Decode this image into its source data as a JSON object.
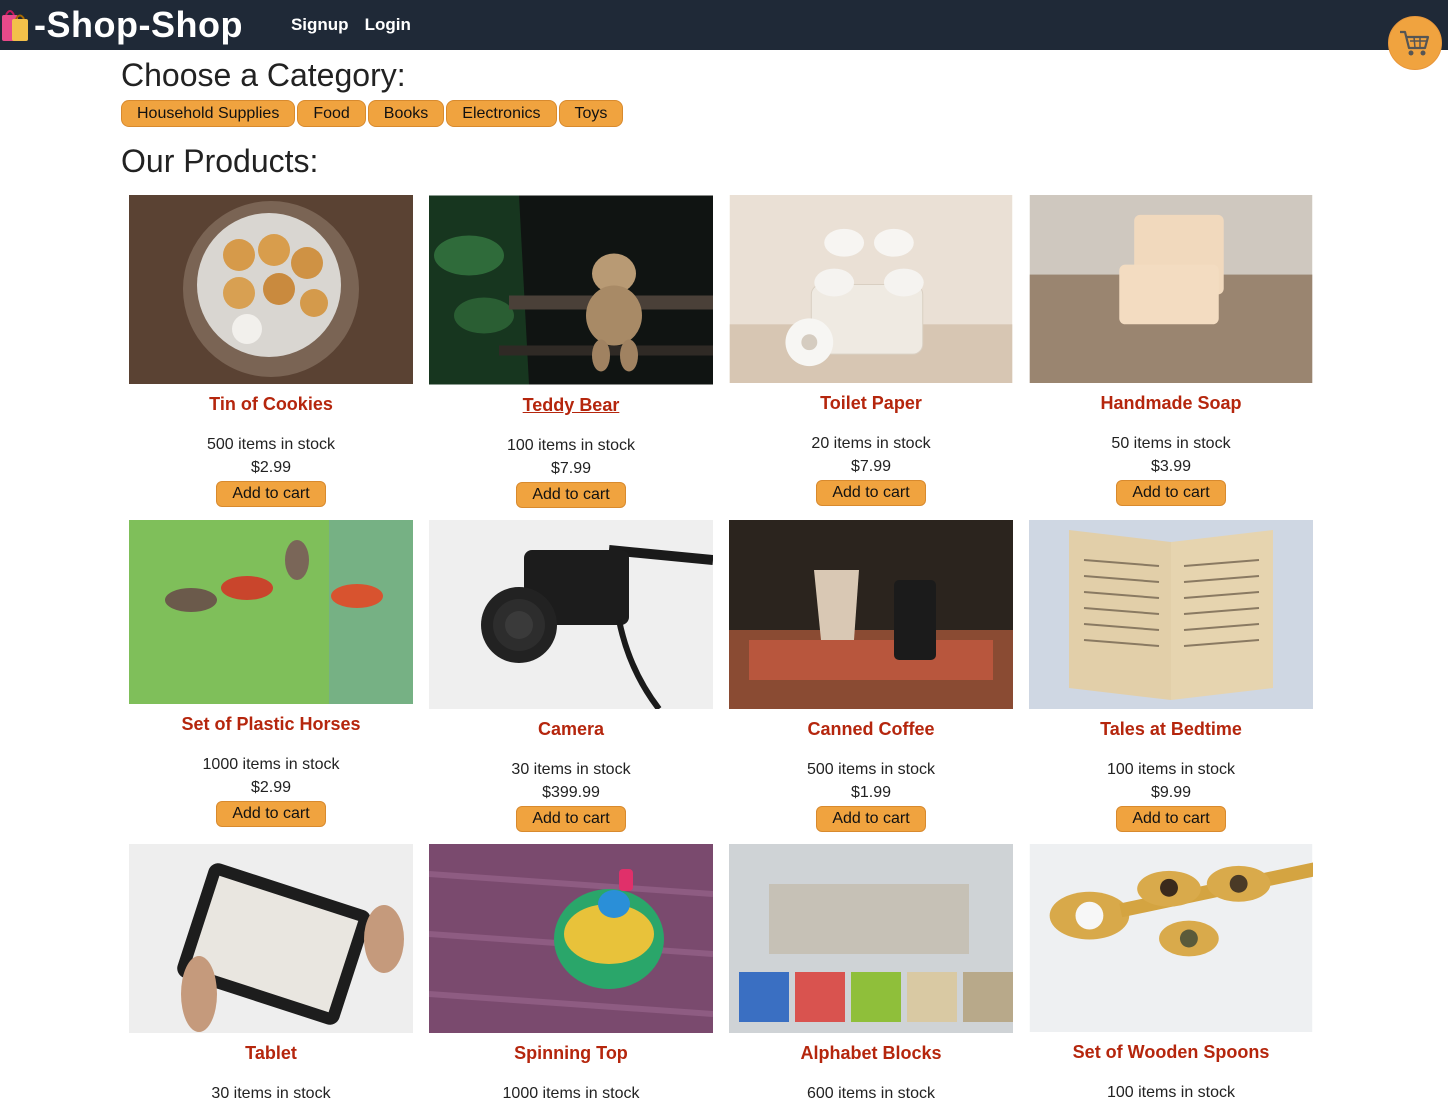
{
  "header": {
    "brand": "-Shop-Shop",
    "logo_icon": "shopping-bags-icon",
    "links": [
      "Signup",
      "Login"
    ],
    "cart_icon": "shopping-cart-icon"
  },
  "categories": {
    "heading": "Choose a Category:",
    "items": [
      "Household Supplies",
      "Food",
      "Books",
      "Electronics",
      "Toys"
    ]
  },
  "products": {
    "heading": "Our Products:",
    "add_label": "Add to cart",
    "items": [
      {
        "name": "Tin of Cookies",
        "stock": "500 items in stock",
        "price": "$2.99"
      },
      {
        "name": "Teddy Bear",
        "stock": "100 items in stock",
        "price": "$7.99"
      },
      {
        "name": "Toilet Paper",
        "stock": "20 items in stock",
        "price": "$7.99"
      },
      {
        "name": "Handmade Soap",
        "stock": "50 items in stock",
        "price": "$3.99"
      },
      {
        "name": "Set of Plastic Horses",
        "stock": "1000 items in stock",
        "price": "$2.99"
      },
      {
        "name": "Camera",
        "stock": "30 items in stock",
        "price": "$399.99"
      },
      {
        "name": "Canned Coffee",
        "stock": "500 items in stock",
        "price": "$1.99"
      },
      {
        "name": "Tales at Bedtime",
        "stock": "100 items in stock",
        "price": "$9.99"
      },
      {
        "name": "Tablet",
        "stock": "30 items in stock",
        "price": ""
      },
      {
        "name": "Spinning Top",
        "stock": "1000 items in stock",
        "price": ""
      },
      {
        "name": "Alphabet Blocks",
        "stock": "600 items in stock",
        "price": ""
      },
      {
        "name": "Set of Wooden Spoons",
        "stock": "100 items in stock",
        "price": ""
      }
    ]
  },
  "colors": {
    "navbar": "#1f2937",
    "accent": "#f0a33f",
    "product_name": "#b5260d"
  }
}
